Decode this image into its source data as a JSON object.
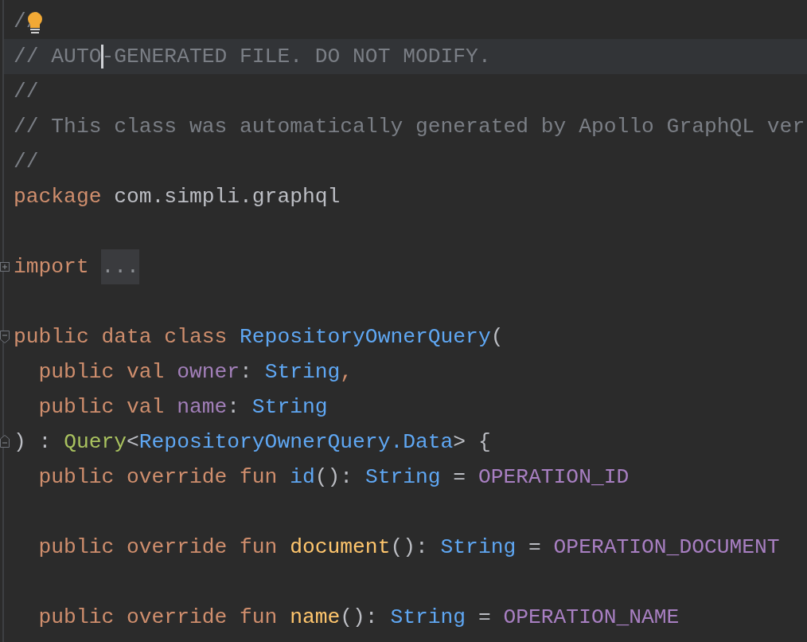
{
  "editor": {
    "lines": [
      {
        "current": false,
        "hint": true,
        "tokens": [
          {
            "kind": "comment",
            "text": "//"
          }
        ]
      },
      {
        "current": true,
        "tokens": [
          {
            "kind": "comment",
            "text": "// AUTO"
          },
          {
            "kind": "comment",
            "text": "-GENERATED FILE. DO NOT MODIFY.",
            "caret_before": true
          }
        ]
      },
      {
        "current": false,
        "tokens": [
          {
            "kind": "comment",
            "text": "//"
          }
        ]
      },
      {
        "current": false,
        "tokens": [
          {
            "kind": "comment",
            "text": "// This class was automatically generated by Apollo GraphQL ver"
          }
        ]
      },
      {
        "current": false,
        "tokens": [
          {
            "kind": "comment",
            "text": "//"
          }
        ]
      },
      {
        "current": false,
        "tokens": [
          {
            "kind": "keyword",
            "text": "package "
          },
          {
            "kind": "plain",
            "text": "com.simpli.graphql"
          }
        ]
      },
      {
        "current": false
      },
      {
        "current": false,
        "fold": {
          "kind": "expand"
        },
        "tokens": [
          {
            "kind": "keyword",
            "text": "import "
          },
          {
            "kind": "folded",
            "text": "..."
          }
        ]
      },
      {
        "current": false
      },
      {
        "current": false,
        "fold": {
          "kind": "collapse"
        },
        "tokens": [
          {
            "kind": "keyword",
            "text": "public data class "
          },
          {
            "kind": "type",
            "text": "RepositoryOwnerQuery"
          },
          {
            "kind": "plain",
            "text": "("
          }
        ]
      },
      {
        "current": false,
        "tokens": [
          {
            "kind": "keyword",
            "text": "  public val "
          },
          {
            "kind": "param",
            "text": "owner"
          },
          {
            "kind": "plain",
            "text": ": "
          },
          {
            "kind": "type",
            "text": "String"
          },
          {
            "kind": "keyword",
            "text": ","
          }
        ]
      },
      {
        "current": false,
        "tokens": [
          {
            "kind": "keyword",
            "text": "  public val "
          },
          {
            "kind": "param",
            "text": "name"
          },
          {
            "kind": "plain",
            "text": ": "
          },
          {
            "kind": "type",
            "text": "String"
          }
        ]
      },
      {
        "current": false,
        "fold": {
          "kind": "end"
        },
        "tokens": [
          {
            "kind": "plain",
            "text": ") : "
          },
          {
            "kind": "interface",
            "text": "Query"
          },
          {
            "kind": "plain",
            "text": "<"
          },
          {
            "kind": "type",
            "text": "RepositoryOwnerQuery.Data"
          },
          {
            "kind": "plain",
            "text": "> {"
          }
        ]
      },
      {
        "current": false,
        "tokens": [
          {
            "kind": "keyword",
            "text": "  public override fun "
          },
          {
            "kind": "type",
            "text": "id"
          },
          {
            "kind": "plain",
            "text": "(): "
          },
          {
            "kind": "type",
            "text": "String"
          },
          {
            "kind": "plain",
            "text": " = "
          },
          {
            "kind": "constant",
            "text": "OPERATION_ID"
          }
        ]
      },
      {
        "current": false
      },
      {
        "current": false,
        "tokens": [
          {
            "kind": "keyword",
            "text": "  public override fun "
          },
          {
            "kind": "function",
            "text": "document"
          },
          {
            "kind": "plain",
            "text": "(): "
          },
          {
            "kind": "type",
            "text": "String"
          },
          {
            "kind": "plain",
            "text": " = "
          },
          {
            "kind": "constant",
            "text": "OPERATION_DOCUMENT"
          }
        ]
      },
      {
        "current": false
      },
      {
        "current": false,
        "tokens": [
          {
            "kind": "keyword",
            "text": "  public override fun "
          },
          {
            "kind": "function",
            "text": "name"
          },
          {
            "kind": "plain",
            "text": "(): "
          },
          {
            "kind": "type",
            "text": "String"
          },
          {
            "kind": "plain",
            "text": " = "
          },
          {
            "kind": "constant",
            "text": "OPERATION_NAME"
          }
        ]
      }
    ]
  }
}
